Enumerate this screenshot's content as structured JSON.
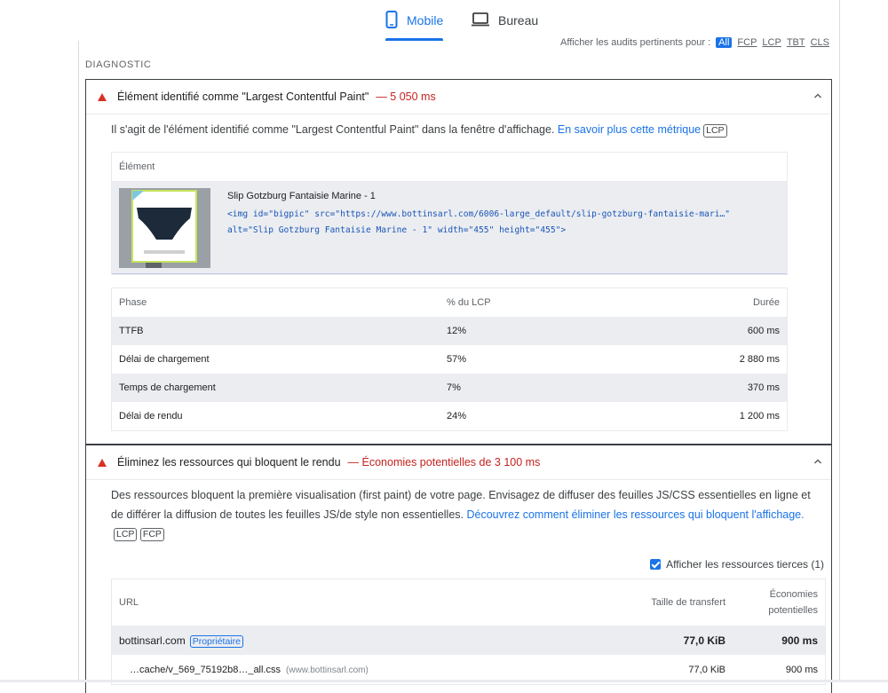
{
  "tabs": {
    "mobile": "Mobile",
    "desktop": "Bureau"
  },
  "filter": {
    "label": "Afficher les audits pertinents pour :",
    "options": [
      "All",
      "FCP",
      "LCP",
      "TBT",
      "CLS"
    ],
    "active": "All"
  },
  "section_label": "DIAGNOSTIC",
  "audit1": {
    "title": "Élément identifié comme \"Largest Contentful Paint\"",
    "value": "— 5 050 ms",
    "description": "Il s'agit de l'élément identifié comme \"Largest Contentful Paint\" dans la fenêtre d'affichage.",
    "link": "En savoir plus cette métrique",
    "badge": "LCP",
    "element_header": "Élément",
    "element_name": "Slip Gotzburg Fantaisie Marine - 1",
    "element_code_line1": "<img id=\"bigpic\" src=\"https://www.bottinsarl.com/6006-large_default/slip-gotzburg-fantaisie-mari…\"",
    "element_code_line2": "alt=\"Slip Gotzburg Fantaisie Marine - 1\" width=\"455\" height=\"455\">",
    "phase_headers": [
      "Phase",
      "% du LCP",
      "Durée"
    ],
    "phases": [
      {
        "phase": "TTFB",
        "pct": "12%",
        "dur": "600 ms"
      },
      {
        "phase": "Délai de chargement",
        "pct": "57%",
        "dur": "2 880 ms"
      },
      {
        "phase": "Temps de chargement",
        "pct": "7%",
        "dur": "370 ms"
      },
      {
        "phase": "Délai de rendu",
        "pct": "24%",
        "dur": "1 200 ms"
      }
    ]
  },
  "audit2": {
    "title": "Éliminez les ressources qui bloquent le rendu",
    "value": "— Économies potentielles de 3 100 ms",
    "description": "Des ressources bloquent la première visualisation (first paint) de votre page. Envisagez de diffuser des feuilles JS/CSS essentielles en ligne et de différer la diffusion de toutes les feuilles JS/de style non essentielles.",
    "link": "Découvrez comment éliminer les ressources qui bloquent l'affichage.",
    "badges": [
      "LCP",
      "FCP"
    ],
    "third_party_label": "Afficher les ressources tierces (1)",
    "third_party_checked": true,
    "url_headers": {
      "url": "URL",
      "transfer": "Taille de transfert",
      "savings_l1": "Économies",
      "savings_l2": "potentielles"
    },
    "group": {
      "host": "bottinsarl.com",
      "tag": "Propriétaire",
      "transfer": "77,0 KiB",
      "savings": "900 ms"
    },
    "rows": [
      {
        "url": "…cache/v_569_75192b8…_all.css",
        "host": "(www.bottinsarl.com)",
        "transfer": "77,0 KiB",
        "savings": "900 ms"
      }
    ]
  }
}
